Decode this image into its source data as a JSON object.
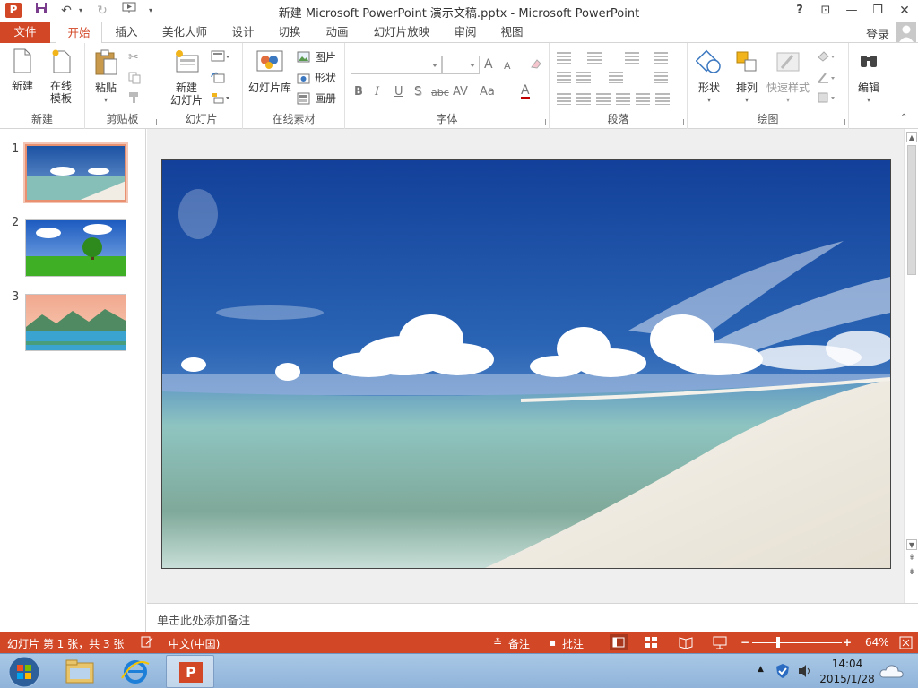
{
  "titlebar": {
    "app_icon_text": "P",
    "title": "新建 Microsoft PowerPoint 演示文稿.pptx - Microsoft PowerPoint",
    "help": "?",
    "ribbon_display": "⊡",
    "minimize": "—",
    "restore": "❐",
    "close": "✕"
  },
  "tabs": {
    "file": "文件",
    "home": "开始",
    "insert": "插入",
    "beautify": "美化大师",
    "design": "设计",
    "transitions": "切换",
    "animations": "动画",
    "slideshow": "幻灯片放映",
    "review": "审阅",
    "view": "视图"
  },
  "account": {
    "login": "登录"
  },
  "ribbon": {
    "new_group": {
      "new": "新建",
      "online_template_1": "在线",
      "online_template_2": "模板",
      "label": "新建"
    },
    "clipboard": {
      "paste": "粘贴",
      "label": "剪贴板"
    },
    "slides": {
      "new_slide_1": "新建",
      "new_slide_2": "幻灯片",
      "label": "幻灯片"
    },
    "online": {
      "library": "幻灯片库",
      "picture": "图片",
      "shape": "形状",
      "album": "画册",
      "label": "在线素材"
    },
    "font": {
      "bold": "B",
      "italic": "I",
      "underline": "U",
      "shadow": "S",
      "strike": "abc",
      "spacing": "AV",
      "case": "Aa",
      "grow": "A",
      "shrink": "A",
      "color": "A",
      "label": "字体"
    },
    "paragraph": {
      "label": "段落"
    },
    "drawing": {
      "shapes": "形状",
      "arrange": "排列",
      "quick_styles": "快速样式",
      "label": "绘图"
    },
    "editing": {
      "label": "编辑"
    }
  },
  "slides": [
    {
      "number": "1",
      "theme": "beach"
    },
    {
      "number": "2",
      "theme": "tree"
    },
    {
      "number": "3",
      "theme": "lake"
    }
  ],
  "notes": {
    "placeholder": "单击此处添加备注"
  },
  "status": {
    "slide_info": "幻灯片 第 1 张，共 3 张",
    "language": "中文(中国)",
    "notes": "备注",
    "comments": "批注",
    "zoom_minus": "−",
    "zoom_plus": "+",
    "zoom": "64%"
  },
  "taskbar": {
    "time": "14:04",
    "date": "2015/1/28",
    "powerpoint_icon_text": "P"
  },
  "colors": {
    "accent": "#d24726",
    "sky": "#1f57a8",
    "sea": "#8ec4c0",
    "sand": "#f1ede4"
  }
}
